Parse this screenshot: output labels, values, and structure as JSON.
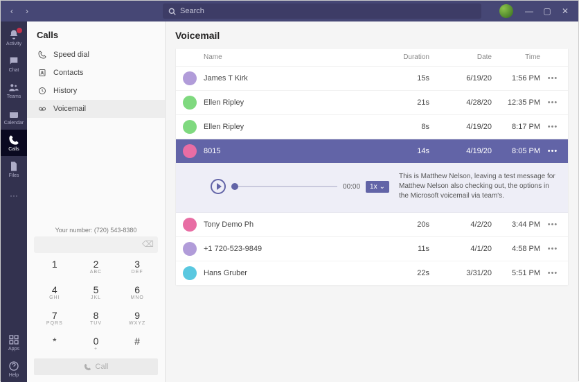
{
  "titlebar": {
    "search_placeholder": "Search"
  },
  "rail": {
    "items": [
      {
        "label": "Activity"
      },
      {
        "label": "Chat"
      },
      {
        "label": "Teams"
      },
      {
        "label": "Calendar"
      },
      {
        "label": "Calls"
      },
      {
        "label": "Files"
      },
      {
        "label": "···"
      }
    ],
    "bottom": [
      {
        "label": "Apps"
      },
      {
        "label": "Help"
      }
    ]
  },
  "sidebar": {
    "title": "Calls",
    "items": [
      {
        "label": "Speed dial"
      },
      {
        "label": "Contacts"
      },
      {
        "label": "History"
      },
      {
        "label": "Voicemail"
      }
    ],
    "your_number_label": "Your number: (720) 543-8380",
    "keys": [
      {
        "n": "1",
        "l": ""
      },
      {
        "n": "2",
        "l": "ABC"
      },
      {
        "n": "3",
        "l": "DEF"
      },
      {
        "n": "4",
        "l": "GHI"
      },
      {
        "n": "5",
        "l": "JKL"
      },
      {
        "n": "6",
        "l": "MNO"
      },
      {
        "n": "7",
        "l": "PQRS"
      },
      {
        "n": "8",
        "l": "TUV"
      },
      {
        "n": "9",
        "l": "WXYZ"
      },
      {
        "n": "*",
        "l": ""
      },
      {
        "n": "0",
        "l": "+"
      },
      {
        "n": "#",
        "l": ""
      }
    ],
    "call_label": "Call"
  },
  "content": {
    "title": "Voicemail",
    "columns": {
      "name": "Name",
      "duration": "Duration",
      "date": "Date",
      "time": "Time"
    },
    "rows": [
      {
        "avatar": "#b19cd9",
        "name": "James T Kirk",
        "duration": "15s",
        "date": "6/19/20",
        "time": "1:56 PM"
      },
      {
        "avatar": "#7fd97f",
        "name": "Ellen Ripley",
        "duration": "21s",
        "date": "4/28/20",
        "time": "12:35 PM"
      },
      {
        "avatar": "#7fd97f",
        "name": "Ellen Ripley",
        "duration": "8s",
        "date": "4/19/20",
        "time": "8:17 PM"
      },
      {
        "avatar": "#e86da4",
        "name": "8015",
        "duration": "14s",
        "date": "4/19/20",
        "time": "8:05 PM",
        "selected": true
      },
      {
        "avatar": "#e86da4",
        "name": "Tony Demo Ph",
        "duration": "20s",
        "date": "4/2/20",
        "time": "3:44 PM"
      },
      {
        "avatar": "#b19cd9",
        "name": "+1 720-523-9849",
        "duration": "11s",
        "date": "4/1/20",
        "time": "4:58 PM"
      },
      {
        "avatar": "#5ac8e0",
        "name": "Hans Gruber",
        "duration": "22s",
        "date": "3/31/20",
        "time": "5:51 PM"
      }
    ],
    "player": {
      "time": "00:00",
      "speed": "1x",
      "transcript": "This is Matthew Nelson, leaving a test message for Matthew Nelson also checking out, the options in the Microsoft voicemail via team's."
    }
  }
}
